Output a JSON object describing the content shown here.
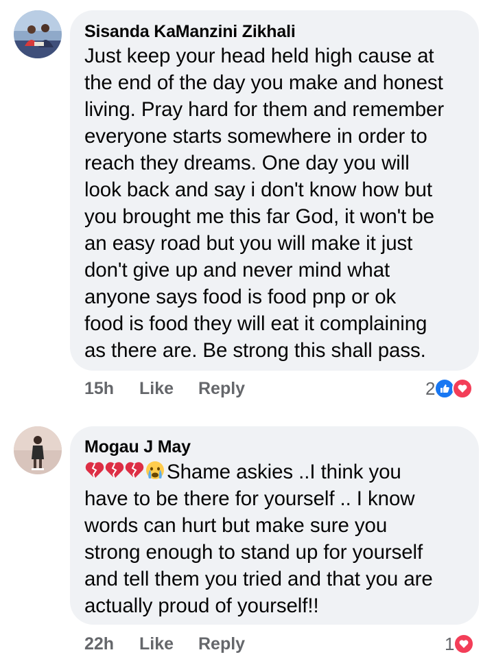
{
  "comments": [
    {
      "author": "Sisanda KaManzini Zikhali",
      "text_lines": [
        "Just keep your head held high cause at",
        "the end of the day you make and honest",
        "living. Pray hard for them and remember",
        "everyone starts somewhere in order to",
        "reach they dreams. One day you will",
        "look back and say i don't know how but",
        "you brought me this far God, it won't be",
        "an easy road but you will make it just",
        "don't give up and never mind what",
        "anyone says food is food pnp or ok",
        "food is food they will eat it complaining",
        "as there are. Be strong this shall pass."
      ],
      "time": "15h",
      "like_label": "Like",
      "reply_label": "Reply",
      "reaction_count": "2",
      "reaction_icons": [
        "like-icon",
        "love-icon"
      ]
    },
    {
      "author": "Mogau J May",
      "emoji_prefix": [
        "broken-heart-icon",
        "broken-heart-icon",
        "broken-heart-icon",
        "crying-face-icon"
      ],
      "text_lines": [
        "Shame askies ..I think you",
        "have to be there for yourself .. I know",
        "words can hurt but make sure you",
        "strong enough to stand up for yourself",
        "and tell them you tried and that you are",
        "actually proud of yourself!!"
      ],
      "time": "22h",
      "like_label": "Like",
      "reply_label": "Reply",
      "reaction_count": "1",
      "reaction_icons": [
        "love-icon"
      ]
    }
  ],
  "colors": {
    "bubble": "#f0f2f5",
    "meta_text": "#65676b",
    "like_blue": "#1877f2",
    "love_red": "#f33e58"
  }
}
